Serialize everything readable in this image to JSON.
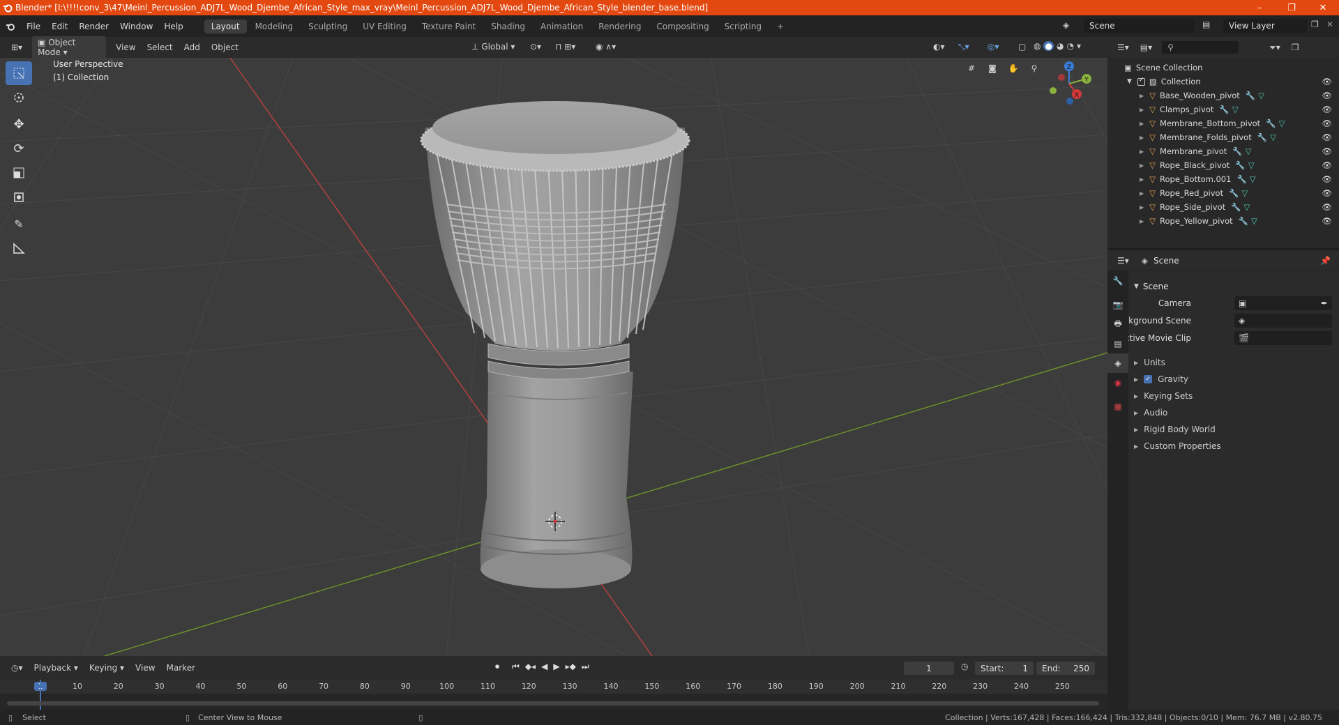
{
  "window": {
    "title": "Blender* [I:\\!!!!conv_3\\47\\Meinl_Percussion_ADJ7L_Wood_Djembe_African_Style_max_vray\\Meinl_Percussion_ADJ7L_Wood_Djembe_African_Style_blender_base.blend]",
    "minimize": "–",
    "maximize": "❐",
    "close": "✕"
  },
  "menus": [
    "File",
    "Edit",
    "Render",
    "Window",
    "Help"
  ],
  "workspaces": [
    "Layout",
    "Modeling",
    "Sculpting",
    "UV Editing",
    "Texture Paint",
    "Shading",
    "Animation",
    "Rendering",
    "Compositing",
    "Scripting"
  ],
  "active_workspace": "Layout",
  "add_workspace": "+",
  "scene_field": "Scene",
  "viewlayer_field": "View Layer",
  "viewport": {
    "mode": "Object Mode",
    "menus": [
      "View",
      "Select",
      "Add",
      "Object"
    ],
    "transform_orientation": "Global",
    "perspective_label": "User Perspective",
    "collection_label": "(1) Collection",
    "gizmo": {
      "x": "X",
      "y": "Y",
      "z": "Z"
    }
  },
  "outliner": {
    "search_placeholder": "",
    "root": "Scene Collection",
    "collection": "Collection",
    "items": [
      "Base_Wooden_pivot",
      "Clamps_pivot",
      "Membrane_Bottom_pivot",
      "Membrane_Folds_pivot",
      "Membrane_pivot",
      "Rope_Black_pivot",
      "Rope_Bottom.001",
      "Rope_Red_pivot",
      "Rope_Side_pivot",
      "Rope_Yellow_pivot"
    ]
  },
  "properties": {
    "header": "Scene",
    "panel": "Scene",
    "camera_label": "Camera",
    "background_scene_label": "Background Scene",
    "active_movie_clip_label": "Active Movie Clip",
    "sections": [
      "Units",
      "Gravity",
      "Keying Sets",
      "Audio",
      "Rigid Body World",
      "Custom Properties"
    ],
    "gravity_checked": true
  },
  "timeline": {
    "menus": [
      "Playback",
      "Keying",
      "View",
      "Marker"
    ],
    "current_frame": "1",
    "start_label": "Start:",
    "start_value": "1",
    "end_label": "End:",
    "end_value": "250",
    "ruler": [
      "1",
      "10",
      "20",
      "30",
      "40",
      "50",
      "60",
      "70",
      "80",
      "90",
      "100",
      "110",
      "120",
      "130",
      "140",
      "150",
      "160",
      "170",
      "180",
      "190",
      "200",
      "210",
      "220",
      "230",
      "240",
      "250"
    ]
  },
  "statusbar": {
    "select": "Select",
    "center_view": "Center View to Mouse",
    "stats": "Collection | Verts:167,428 | Faces:166,424 | Tris:332,848 | Objects:0/10 | Mem: 76.7 MB | v2.80.75"
  },
  "colors": {
    "accent": "#4772b3",
    "titlebar": "#e2480f",
    "x_axis": "#c0392b",
    "y_axis": "#7aa532"
  }
}
